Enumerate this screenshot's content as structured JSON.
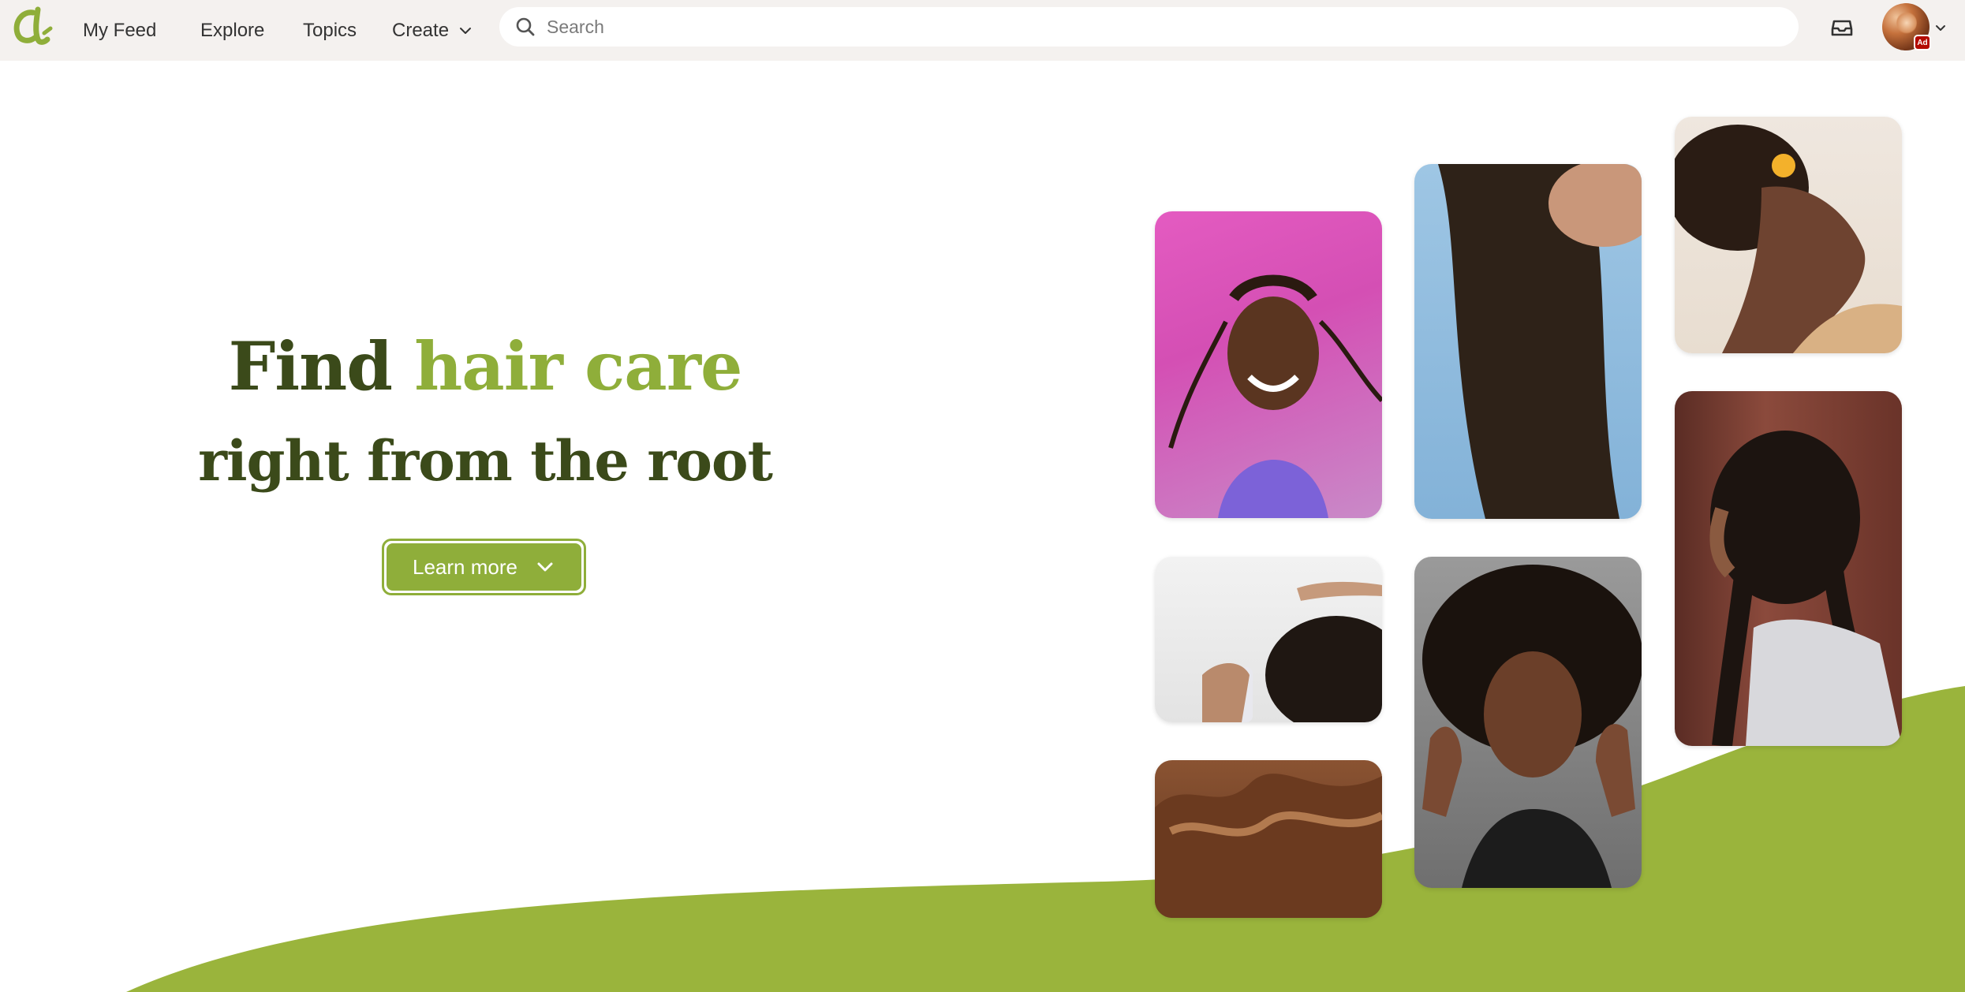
{
  "nav": {
    "links": [
      "My Feed",
      "Explore",
      "Topics",
      "Create"
    ],
    "search_placeholder": "Search",
    "avatar_badge": "Ad"
  },
  "hero": {
    "title_part1": "Find",
    "title_accent": "hair care",
    "title_line2": "right from the root",
    "cta_label": "Learn more"
  },
  "colors": {
    "nav_bg": "#f4f1ef",
    "brand_green": "#8fae3a",
    "wave_green": "#9ab43c",
    "heading_dark": "#3b4a1a"
  },
  "icons": [
    "logo",
    "chevron-down-icon",
    "search-icon",
    "inbox-icon",
    "avatar",
    "chevron-down-icon"
  ]
}
